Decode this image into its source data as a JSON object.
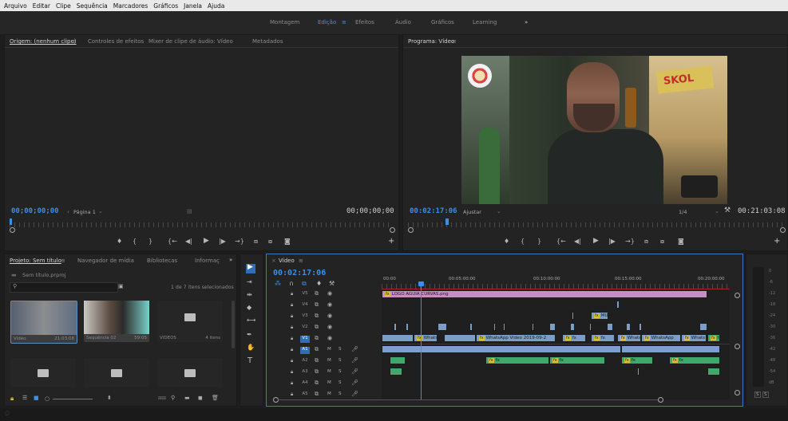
{
  "menu": [
    "Arquivo",
    "Editar",
    "Clipe",
    "Sequência",
    "Marcadores",
    "Gráficos",
    "Janela",
    "Ajuda"
  ],
  "workspaces": [
    {
      "label": "Montagem"
    },
    {
      "label": "Edição"
    },
    {
      "label": "Efeitos"
    },
    {
      "label": "Áudio"
    },
    {
      "label": "Gráficos"
    },
    {
      "label": "Learning"
    }
  ],
  "workspace_menu_icon": "≡",
  "workspace_more": "»",
  "source_panel": {
    "tabs": [
      "Origem: (nenhum clipe)",
      "Controles de efeitos",
      "Mixer de clipe de áudio: Vídeo",
      "Metadados"
    ],
    "tab_menu": "≡",
    "timecode_left": "00;00;00;00",
    "timecode_right": "00;00;00;00",
    "page_select": "Página 1"
  },
  "program_panel": {
    "title": "Programa: Vídeo",
    "tab_menu": "≡",
    "timecode": "00:02:17:06",
    "fit": "Ajustar",
    "ratio": "1/4",
    "duration": "00:21:03:08",
    "video_overlay": {
      "beer_sign": "SKOL"
    }
  },
  "project_panel": {
    "tabs": [
      "Projeto: Sem título",
      "Navegador de mídia",
      "Bibliotecas",
      "Informaç"
    ],
    "tab_menu": "≡",
    "more": "»",
    "project_file": "Sem título.prproj",
    "selected_count": "1 de 7 itens selecionados",
    "items": [
      {
        "name": "Vídeo",
        "meta": "21:03:08"
      },
      {
        "name": "Sequência 02",
        "meta": "59:05"
      },
      {
        "name": "VIDEOS",
        "meta": "4 itens"
      },
      {
        "name": "",
        "meta": ""
      },
      {
        "name": "",
        "meta": ""
      },
      {
        "name": "",
        "meta": ""
      }
    ]
  },
  "timeline": {
    "tab": "Vídeo",
    "tab_menu": "≡",
    "close": "×",
    "timecode": "00:02:17:06",
    "ruler": [
      "00:00",
      "00:05:00:00",
      "00:10:00:00",
      "00:15:00:00",
      "00:20:00:00"
    ],
    "tracks": [
      "V5",
      "V4",
      "V3",
      "V2",
      "V1",
      "A1",
      "A2",
      "A3",
      "A4",
      "A5"
    ],
    "clip_labels": {
      "v5": "LOGO AGUIA CURVAS.png",
      "v3": "MUSIC",
      "v1a": "WhatsA",
      "v1b": "WhatsApp Video 2019-09-2",
      "v1c": "Whats",
      "v1d": "WhatsApp",
      "v1e": "Whats",
      "fx": "fx"
    },
    "track_btn_m": "M",
    "track_btn_s": "S"
  },
  "meter": {
    "scale": [
      "0",
      "-6",
      "-12",
      "-18",
      "-24",
      "-30",
      "-36",
      "-42",
      "-48",
      "-54",
      "dB"
    ],
    "solo": [
      "S",
      "S"
    ]
  },
  "colors": {
    "accent": "#3b8eea",
    "video_clip": "#7a9ec6",
    "audio_clip": "#7c9ed4",
    "green_clip": "#3fa86a",
    "pink_clip": "#c58fc6"
  }
}
